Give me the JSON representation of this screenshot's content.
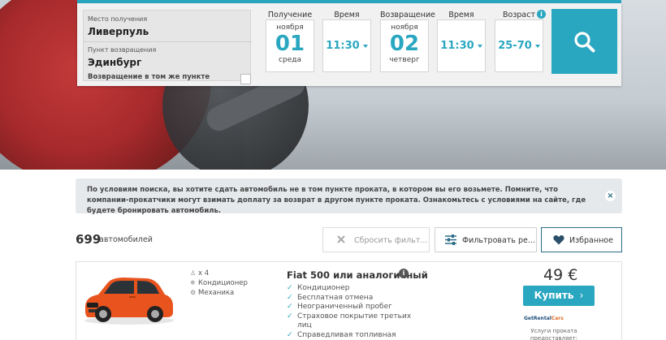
{
  "search": {
    "pickup_location_label": "Место получения",
    "pickup_location": "Ливерпуль",
    "return_location_label": "Пункт возвращения",
    "return_location": "Эдинбург",
    "same_location_label": "Возвращение в том же пункте",
    "pickup_label": "Получение",
    "pickup_month": "ноября",
    "pickup_day": "01",
    "pickup_weekday": "среда",
    "time_label": "Время",
    "pickup_time": "11:30",
    "return_label": "Возвращение",
    "return_month": "ноября",
    "return_day": "02",
    "return_weekday": "четверг",
    "return_time": "11:30",
    "age_label": "Возраст",
    "age": "25-70"
  },
  "notice": {
    "text": "По условиям поиска, вы хотите сдать автомобиль не в том пункте проката, в котором вы его возьмете. Помните, что компании-прокатчики могут взимать доплату за возврат в другом пункте проката. Ознакомьтесь с условиями на сайте, где будете бронировать автомобиль.",
    "close": "×"
  },
  "results": {
    "count": "699",
    "count_label": "автомобилей",
    "reset_filters": "Сбросить фильт...",
    "filter": "Фильтровать ре...",
    "favorites": "Избранное"
  },
  "card": {
    "seats": "x 4",
    "spec_ac": "Кондиционер",
    "spec_transmission": "Механика",
    "name": "Fiat 500 или аналогичный",
    "features": [
      "Кондиционер",
      "Бесплатная отмена",
      "Неограниченный пробег",
      "Страховое покрытие третьих",
      "лиц",
      "Справедливая топливная"
    ],
    "price": "49 €",
    "buy_label": "Купить",
    "supplier_a": "GetRental",
    "supplier_b": "Cars",
    "supplier_note": "Услуги проката предоставляет:"
  },
  "colors": {
    "accent": "#2aa7c0",
    "car": "#e8531e"
  }
}
